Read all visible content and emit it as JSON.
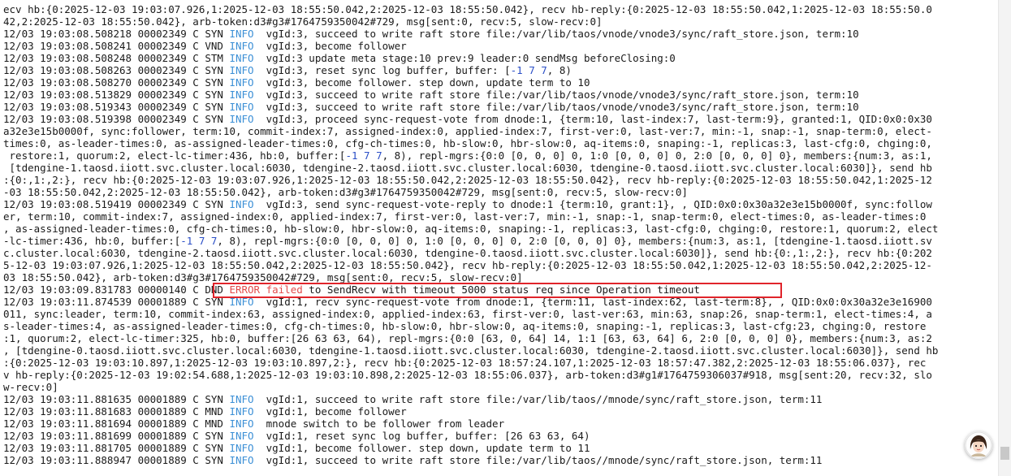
{
  "terminal": {
    "lines": [
      [
        {
          "t": "ecv hb:{0:2025-12-03 19:03:07.926,1:2025-12-03 18:55:50.042,2:2025-12-03 18:55:50.042}, recv hb-reply:{0:2025-12-03 18:55:50.042,1:2025-12-03 18:55:50.0"
        }
      ],
      [
        {
          "t": "42,2:2025-12-03 18:55:50.042}, arb-token:d3#g3#1764759350042#729, msg[sent:0, recv:5, slow-recv:0]"
        }
      ],
      [
        {
          "t": "12/03 19:03:08.508218 00002349 C SYN "
        },
        {
          "t": "INFO",
          "c": "info"
        },
        {
          "t": "  vgId:3, succeed to write raft store file:/var/lib/taos/vnode/vnode3/sync/raft_store.json, term:10"
        }
      ],
      [
        {
          "t": "12/03 19:03:08.508241 00002349 C VND "
        },
        {
          "t": "INFO",
          "c": "info"
        },
        {
          "t": "  vgId:3, become follower"
        }
      ],
      [
        {
          "t": "12/03 19:03:08.508248 00002349 C STM "
        },
        {
          "t": "INFO",
          "c": "info"
        },
        {
          "t": "  vgId:3 update meta stage:10 prev:9 leader:0 sendMsg beforeClosing:0"
        }
      ],
      [
        {
          "t": "12/03 19:03:08.508263 00002349 C SYN "
        },
        {
          "t": "INFO",
          "c": "info"
        },
        {
          "t": "  vgId:3, reset sync log buffer, buffer: ["
        },
        {
          "t": "-1 7 7",
          "c": "num"
        },
        {
          "t": ", 8)"
        }
      ],
      [
        {
          "t": "12/03 19:03:08.508270 00002349 C SYN "
        },
        {
          "t": "INFO",
          "c": "info"
        },
        {
          "t": "  vgId:3, become follower. step down, update term to 10"
        }
      ],
      [
        {
          "t": "12/03 19:03:08.513829 00002349 C SYN "
        },
        {
          "t": "INFO",
          "c": "info"
        },
        {
          "t": "  vgId:3, succeed to write raft store file:/var/lib/taos/vnode/vnode3/sync/raft_store.json, term:10"
        }
      ],
      [
        {
          "t": "12/03 19:03:08.519343 00002349 C SYN "
        },
        {
          "t": "INFO",
          "c": "info"
        },
        {
          "t": "  vgId:3, succeed to write raft store file:/var/lib/taos/vnode/vnode3/sync/raft_store.json, term:10"
        }
      ],
      [
        {
          "t": "12/03 19:03:08.519398 00002349 C SYN "
        },
        {
          "t": "INFO",
          "c": "info"
        },
        {
          "t": "  vgId:3, proceed sync-request-vote from dnode:1, {term:10, last-index:7, last-term:9}, granted:1, QID:0x0:0x30"
        }
      ],
      [
        {
          "t": "a32e3e15b0000f, sync:follower, term:10, commit-index:7, assigned-index:0, applied-index:7, first-ver:0, last-ver:7, min:-1, snap:-1, snap-term:0, elect-"
        }
      ],
      [
        {
          "t": "times:0, as-leader-times:0, as-assigned-leader-times:0, cfg-ch-times:0, hb-slow:0, hbr-slow:0, aq-items:0, snaping:-1, replicas:3, last-cfg:0, chging:0,"
        }
      ],
      [
        {
          "t": " restore:1, quorum:2, elect-lc-timer:436, hb:0, buffer:["
        },
        {
          "t": "-1 7 7",
          "c": "num"
        },
        {
          "t": ", 8), repl-mgrs:{0:0 [0, 0, 0] 0, 1:0 [0, 0, 0] 0, 2:0 [0, 0, 0] 0}, members:{num:3, as:1,"
        }
      ],
      [
        {
          "t": " [tdengine-1.taosd.iiott.svc.cluster.local:6030, tdengine-2.taosd.iiott.svc.cluster.local:6030, tdengine-0.taosd.iiott.svc.cluster.local:6030]}, send hb"
        }
      ],
      [
        {
          "t": ":{0:,1:,2:}, recv hb:{0:2025-12-03 19:03:07.926,1:2025-12-03 18:55:50.042,2:2025-12-03 18:55:50.042}, recv hb-reply:{0:2025-12-03 18:55:50.042,1:2025-12"
        }
      ],
      [
        {
          "t": "-03 18:55:50.042,2:2025-12-03 18:55:50.042}, arb-token:d3#g3#1764759350042#729, msg[sent:0, recv:5, slow-recv:0]"
        }
      ],
      [
        {
          "t": "12/03 19:03:08.519419 00002349 C SYN "
        },
        {
          "t": "INFO",
          "c": "info"
        },
        {
          "t": "  vgId:3, send sync-request-vote-reply to dnode:1 {term:10, grant:1}, , QID:0x0:0x30a32e3e15b0000f, sync:follow"
        }
      ],
      [
        {
          "t": "er, term:10, commit-index:7, assigned-index:0, applied-index:7, first-ver:0, last-ver:7, min:-1, snap:-1, snap-term:0, elect-times:0, as-leader-times:0"
        }
      ],
      [
        {
          "t": ", as-assigned-leader-times:0, cfg-ch-times:0, hb-slow:0, hbr-slow:0, aq-items:0, snaping:-1, replicas:3, last-cfg:0, chging:0, restore:1, quorum:2, elect"
        }
      ],
      [
        {
          "t": "-lc-timer:436, hb:0, buffer:["
        },
        {
          "t": "-1 7 7",
          "c": "num"
        },
        {
          "t": ", 8), repl-mgrs:{0:0 [0, 0, 0] 0, 1:0 [0, 0, 0] 0, 2:0 [0, 0, 0] 0}, members:{num:3, as:1, [tdengine-1.taosd.iiott.sv"
        }
      ],
      [
        {
          "t": "c.cluster.local:6030, tdengine-2.taosd.iiott.svc.cluster.local:6030, tdengine-0.taosd.iiott.svc.cluster.local:6030]}, send hb:{0:,1:,2:}, recv hb:{0:202"
        }
      ],
      [
        {
          "t": "5-12-03 19:03:07.926,1:2025-12-03 18:55:50.042,2:2025-12-03 18:55:50.042}, recv hb-reply:{0:2025-12-03 18:55:50.042,1:2025-12-03 18:55:50.042,2:2025-12-"
        }
      ],
      [
        {
          "t": "03 18:55:50.042}, arb-token:d3#g3#1764759350042#729, msg[sent:0, recv:5, slow-recv:0]"
        }
      ],
      [
        {
          "t": "12/03 19:03:09.831783 00000140 C DND "
        },
        {
          "t": "ERROR failed",
          "c": "err"
        },
        {
          "t": " to SendRecv with timeout 5000 status req since Operation timeout"
        }
      ],
      [
        {
          "t": "12/03 19:03:11.874539 00001889 C SYN "
        },
        {
          "t": "INFO",
          "c": "info"
        },
        {
          "t": "  vgId:1, recv sync-request-vote from dnode:1, {term:11, last-index:62, last-term:8}, , QID:0x0:0x30a32e3e16900"
        }
      ],
      [
        {
          "t": "011, sync:leader, term:10, commit-index:63, assigned-index:0, applied-index:63, first-ver:0, last-ver:63, min:63, snap:26, snap-term:1, elect-times:4, a"
        }
      ],
      [
        {
          "t": "s-leader-times:4, as-assigned-leader-times:0, cfg-ch-times:0, hb-slow:0, hbr-slow:0, aq-items:0, snaping:-1, replicas:3, last-cfg:23, chging:0, restore"
        }
      ],
      [
        {
          "t": ":1, quorum:2, elect-lc-timer:325, hb:0, buffer:[26 63 63, 64), repl-mgrs:{0:0 [63, 0, 64] 14, 1:1 [63, 63, 64] 6, 2:0 [0, 0, 0] 0}, members:{num:3, as:2"
        }
      ],
      [
        {
          "t": ", [tdengine-0.taosd.iiott.svc.cluster.local:6030, tdengine-1.taosd.iiott.svc.cluster.local:6030, tdengine-2.taosd.iiott.svc.cluster.local:6030]}, send hb"
        }
      ],
      [
        {
          "t": ":{0:2025-12-03 19:03:10.897,1:2025-12-03 19:03:10.897,2:}, recv hb:{0:2025-12-03 18:57:24.107,1:2025-12-03 18:57:47.382,2:2025-12-03 18:55:06.037}, rec"
        }
      ],
      [
        {
          "t": "v hb-reply:{0:2025-12-03 19:02:54.688,1:2025-12-03 19:03:10.898,2:2025-12-03 18:55:06.037}, arb-token:d3#g1#1764759306037#918, msg[sent:20, recv:32, slo"
        }
      ],
      [
        {
          "t": "w-recv:0]"
        }
      ],
      [
        {
          "t": "12/03 19:03:11.881635 00001889 C SYN "
        },
        {
          "t": "INFO",
          "c": "info"
        },
        {
          "t": "  vgId:1, succeed to write raft store file:/var/lib/taos//mnode/sync/raft_store.json, term:11"
        }
      ],
      [
        {
          "t": "12/03 19:03:11.881683 00001889 C MND "
        },
        {
          "t": "INFO",
          "c": "info"
        },
        {
          "t": "  vgId:1, become follower"
        }
      ],
      [
        {
          "t": "12/03 19:03:11.881694 00001889 C MND "
        },
        {
          "t": "INFO",
          "c": "info"
        },
        {
          "t": "  mnode switch to be follower from leader"
        }
      ],
      [
        {
          "t": "12/03 19:03:11.881699 00001889 C SYN "
        },
        {
          "t": "INFO",
          "c": "info"
        },
        {
          "t": "  vgId:1, reset sync log buffer, buffer: [26 63 63, 64)"
        }
      ],
      [
        {
          "t": "12/03 19:03:11.881705 00001889 C SYN "
        },
        {
          "t": "INFO",
          "c": "info"
        },
        {
          "t": "  vgId:1, become follower. step down, update term to 11"
        }
      ],
      [
        {
          "t": "12/03 19:03:11.888947 00001889 C SYN "
        },
        {
          "t": "INFO",
          "c": "info"
        },
        {
          "t": "  vgId:1, succeed to write raft store file:/var/lib/taos//mnode/sync/raft_store.json, term:11"
        }
      ]
    ]
  },
  "colors": {
    "info": "#3b8fd6",
    "error": "#e34a4a",
    "highlight_box": "#e0242b",
    "text": "#1a1a1a"
  },
  "floating_avatar": {
    "icon": "avatar-icon"
  }
}
